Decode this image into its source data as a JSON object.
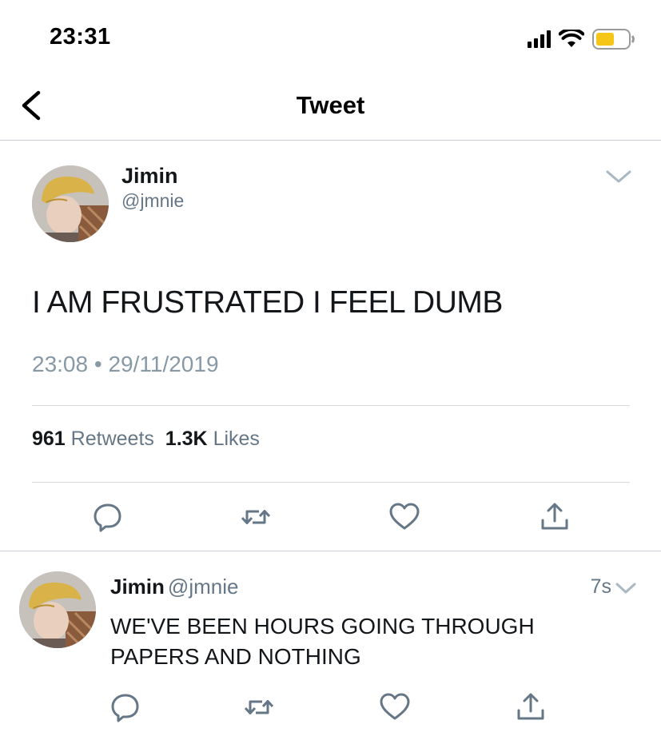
{
  "status_bar": {
    "time": "23:31",
    "icons": [
      "signal-icon",
      "wifi-icon",
      "battery-icon"
    ],
    "battery_color": "#f5c518"
  },
  "header": {
    "back_icon": "chevron-left-icon",
    "title": "Tweet"
  },
  "main_tweet": {
    "author": {
      "name": "Jimin",
      "handle": "@jmnie"
    },
    "text": "I AM FRUSTRATED I FEEL DUMB",
    "time": "23:08",
    "separator": "•",
    "date": "29/11/2019",
    "stats": {
      "retweets_count": "961",
      "retweets_label": "Retweets",
      "likes_count": "1.3K",
      "likes_label": "Likes"
    },
    "actions": [
      "reply-icon",
      "retweet-icon",
      "like-icon",
      "share-icon"
    ]
  },
  "reply": {
    "author": {
      "name": "Jimin",
      "handle": "@jmnie"
    },
    "time": "7s",
    "text": "WE'VE BEEN HOURS GOING THROUGH PAPERS AND NOTHING",
    "actions": [
      "reply-icon",
      "retweet-icon",
      "like-icon",
      "share-icon"
    ]
  },
  "colors": {
    "text_primary": "#14171a",
    "text_secondary": "#657786",
    "action_icon": "#657786",
    "divider": "#c9cdd1"
  }
}
